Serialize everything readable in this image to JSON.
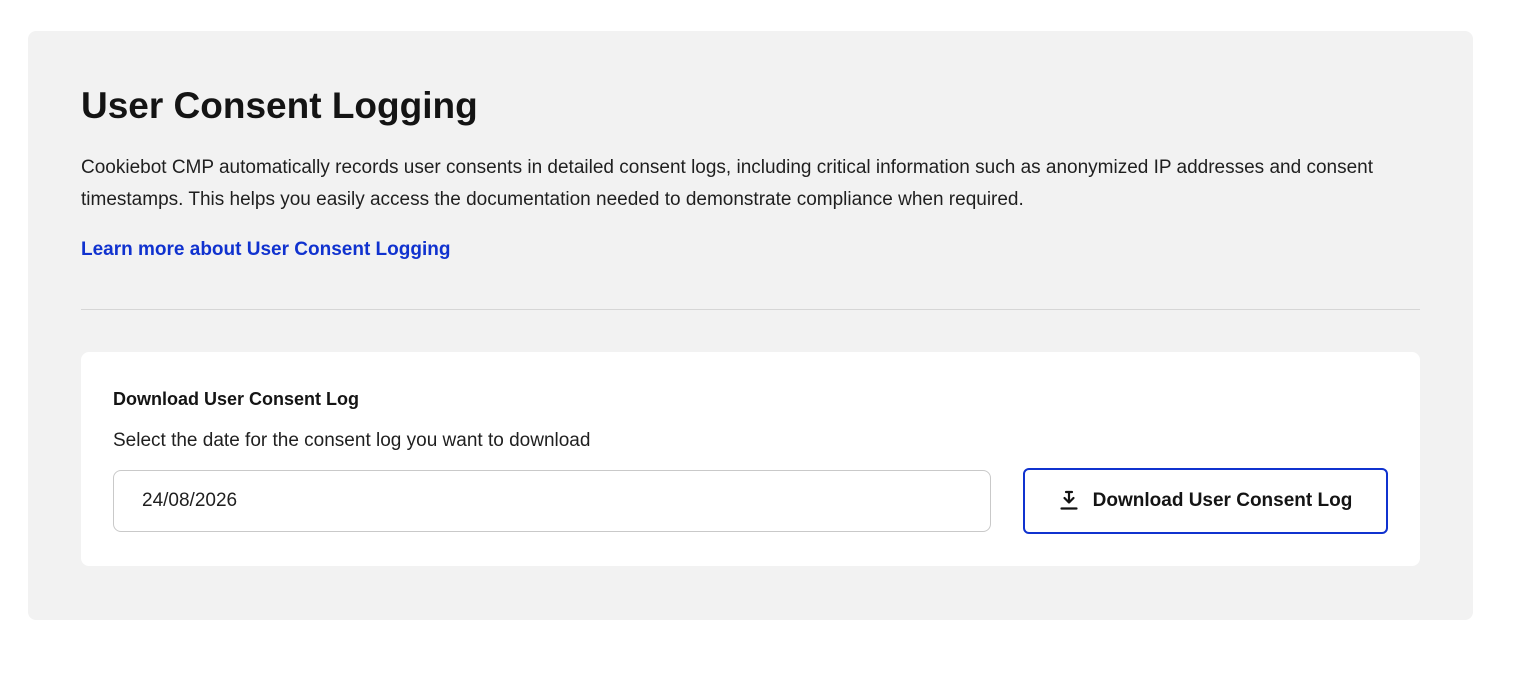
{
  "section": {
    "title": "User Consent Logging",
    "description": "Cookiebot CMP automatically records user consents in detailed consent logs, including critical information such as anonymized IP addresses and consent timestamps. This helps you easily access the documentation needed to demonstrate compliance when required.",
    "learn_more_link": "Learn more about User Consent Logging",
    "link_color": "#1032cf"
  },
  "download_card": {
    "title": "Download User Consent Log",
    "helper_text": "Select the date for the consent log you want to download",
    "date_value": "24/08/2026",
    "button_label": "Download User Consent Log",
    "button_icon": "download-icon",
    "accent_color": "#1032cf"
  }
}
